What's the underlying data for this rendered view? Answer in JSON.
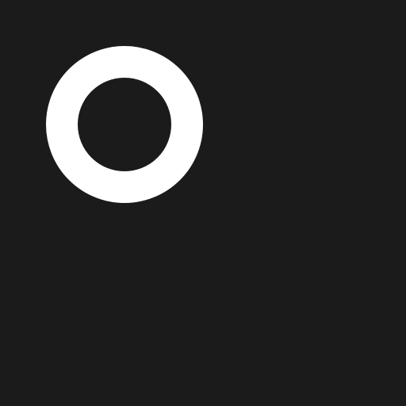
{
  "canvas": {
    "background_color": "#1b1b1b"
  },
  "ring": {
    "icon": "ring-icon",
    "color": "#ffffff"
  }
}
